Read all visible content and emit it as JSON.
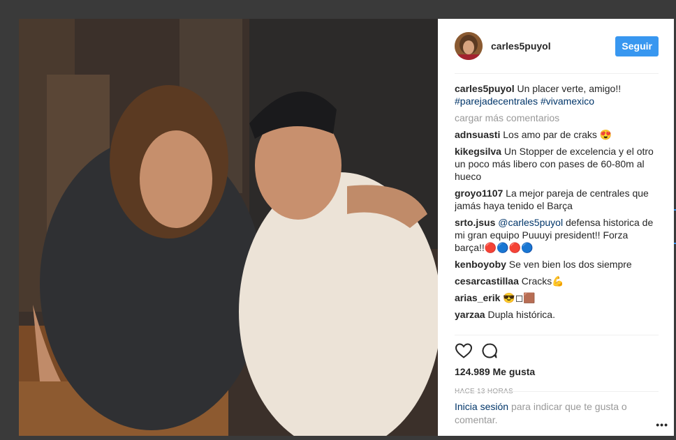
{
  "header": {
    "username": "carles5puyol",
    "follow_label": "Seguir"
  },
  "caption": {
    "user": "carles5puyol",
    "text": "Un placer verte, amigo!!",
    "hashtags": "#parejadecentrales #vivamexico"
  },
  "load_more_label": "cargar más comentarios",
  "comments": [
    {
      "user": "adnsuasti",
      "text": "Los amo par de craks 😍"
    },
    {
      "user": "kikegsilva",
      "text": "Un Stopper de excelencia y el otro un poco más libero con pases de 60-80m al hueco"
    },
    {
      "user": "groyo1107",
      "text": "La mejor pareja de centrales que jamás haya tenido el Barça"
    },
    {
      "user": "srto.jsus",
      "mention": "@carles5puyol",
      "text": "defensa historica de mi gran equipo Puuuyi president!! Forza barça!!🔴🔵🔴🔵"
    },
    {
      "user": "kenboyoby",
      "text": "Se ven bien los dos siempre"
    },
    {
      "user": "cesarcastillaa",
      "text": "Cracks💪"
    },
    {
      "user": "arias_erik",
      "text": "😎◻🟫"
    },
    {
      "user": "yarzaa",
      "text": "Dupla histórica."
    }
  ],
  "likes": "124.989 Me gusta",
  "time": "HACE 13 HORAS",
  "login": {
    "link": "Inicia sesión",
    "rest": "para indicar que te gusta o comentar."
  },
  "more_label": "•••",
  "icons": {
    "like": "heart-icon",
    "comment": "comment-icon",
    "more": "more-dots-icon"
  },
  "colors": {
    "accent": "#3897f0",
    "link": "#003569",
    "muted": "#999999"
  }
}
